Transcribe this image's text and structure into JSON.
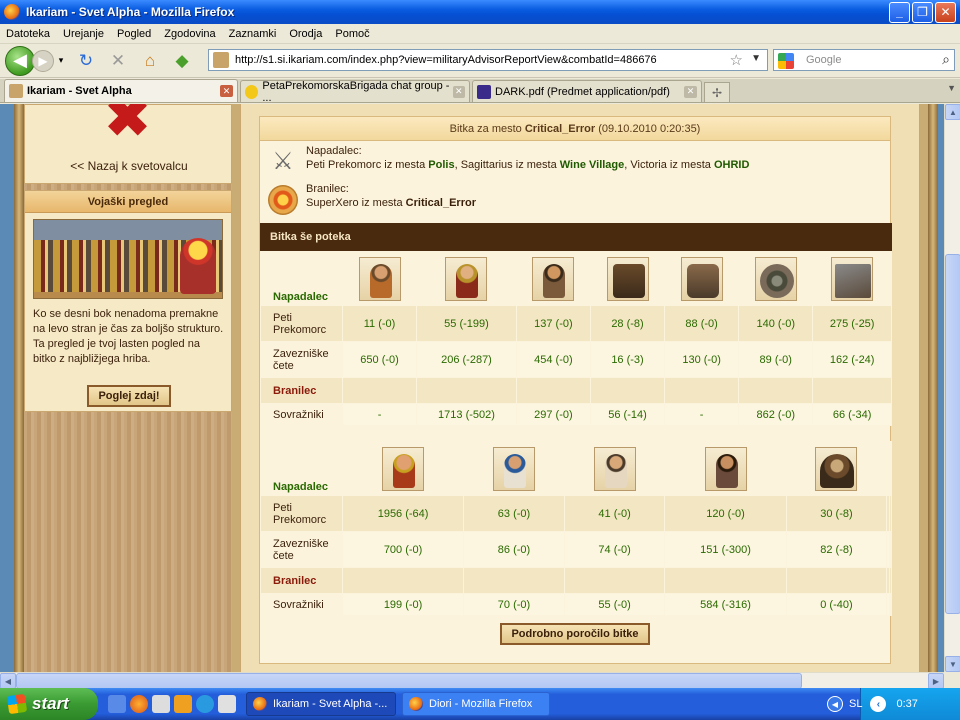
{
  "window": {
    "title": "Ikariam - Svet Alpha - Mozilla Firefox"
  },
  "menu": [
    "Datoteka",
    "Urejanje",
    "Pogled",
    "Zgodovina",
    "Zaznamki",
    "Orodja",
    "Pomoč"
  ],
  "nav": {
    "url": "http://s1.si.ikariam.com/index.php?view=militaryAdvisorReportView&combatId=486676",
    "search_placeholder": "Google"
  },
  "tabs": [
    {
      "label": "Ikariam - Svet Alpha",
      "active": true
    },
    {
      "label": "PetaPrekomorskaBrigada chat group - ...",
      "active": false
    },
    {
      "label": "DARK.pdf (Predmet application/pdf)",
      "active": false
    }
  ],
  "sidebar": {
    "back_link": "<< Nazaj k svetovalcu",
    "overview_title": "Vojaški pregled",
    "advice": "Ko se desni bok nenadoma premakne na levo stran je čas za boljšo strukturo. Ta pregled je tvoj lasten pogled na bitko z najbližjega hriba.",
    "look_button": "Poglej zdaj!"
  },
  "report": {
    "title_prefix": "Bitka za mesto ",
    "title_city": "Critical_Error",
    "title_date": " (09.10.2010 0:20:35)",
    "attacker_label": "Napadalec:",
    "attackers": [
      {
        "player": "Peti Prekomorc",
        "sep": " iz mesta ",
        "city": "Polis",
        "comma": ", "
      },
      {
        "player": "Sagittarius",
        "sep": " iz mesta ",
        "city": "Wine Village",
        "comma": ", "
      },
      {
        "player": "Victoria",
        "sep": " iz mesta ",
        "city": "OHRID",
        "comma": ""
      }
    ],
    "defender_label": "Branilec:",
    "defender": {
      "player": "SuperXero",
      "sep": " iz mesta ",
      "city": "Critical_Error"
    },
    "section_title": "Bitka še poteka",
    "attacker_heading": "Napadalec",
    "defender_heading": "Branilec",
    "row_labels": {
      "peti": "Peti Prekomorc",
      "allies": "Zavezniške čete",
      "enemies": "Sovražniki"
    },
    "table1": {
      "peti": [
        "11 (-0)",
        "55 (-199)",
        "137 (-0)",
        "28 (-8)",
        "88 (-0)",
        "140 (-0)",
        "275 (-25)"
      ],
      "allies": [
        "650 (-0)",
        "206 (-287)",
        "454 (-0)",
        "16 (-3)",
        "130 (-0)",
        "89 (-0)",
        "162 (-24)"
      ],
      "enemies": [
        "-",
        "1713 (-502)",
        "297 (-0)",
        "56 (-14)",
        "-",
        "862 (-0)",
        "66 (-34)"
      ]
    },
    "table2": {
      "peti": [
        "1956 (-64)",
        "63 (-0)",
        "41 (-0)",
        "120 (-0)",
        "30 (-8)",
        ""
      ],
      "allies": [
        "700 (-0)",
        "86 (-0)",
        "74 (-0)",
        "151 (-300)",
        "82 (-8)",
        ""
      ],
      "enemies": [
        "199 (-0)",
        "70 (-0)",
        "55 (-0)",
        "584 (-316)",
        "0 (-40)",
        ""
      ]
    },
    "detail_button": "Podrobno poročilo bitke"
  },
  "taskbar": {
    "start": "start",
    "tasks": [
      "Ikariam - Svet Alpha -...",
      "Diori - Mozilla Firefox"
    ],
    "lang": "SL",
    "time": "0:37"
  }
}
